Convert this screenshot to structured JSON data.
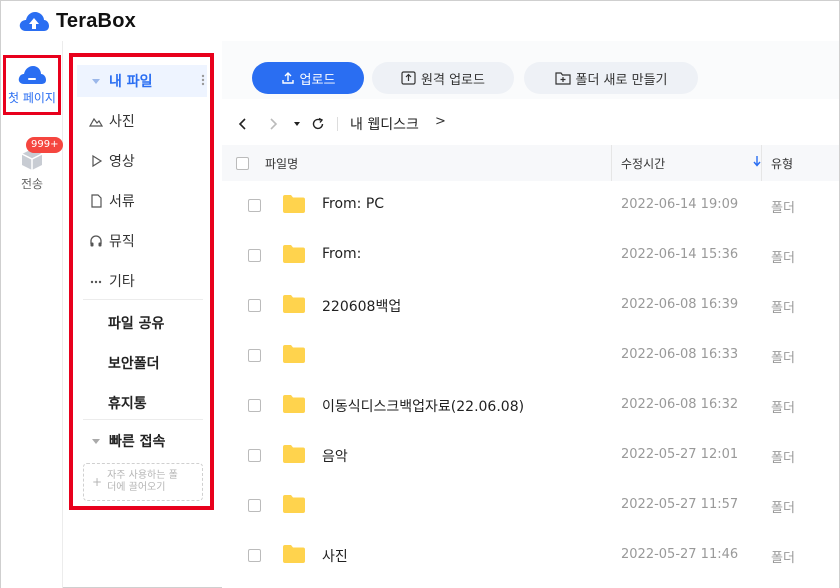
{
  "app": {
    "name": "TeraBox"
  },
  "rail": {
    "home_label": "첫 페이지",
    "transfer_label": "전송",
    "transfer_badge": "999+"
  },
  "sidebar": {
    "items": [
      {
        "label": "내 파일",
        "icon": "triangle-down-icon",
        "active": true
      },
      {
        "label": "사진",
        "icon": "mountain-icon"
      },
      {
        "label": "영상",
        "icon": "play-icon"
      },
      {
        "label": "서류",
        "icon": "document-icon"
      },
      {
        "label": "뮤직",
        "icon": "headphones-icon"
      },
      {
        "label": "기타",
        "icon": "ellipsis-icon"
      }
    ],
    "share_label": "파일 공유",
    "secure_label": "보안폴더",
    "trash_label": "휴지통",
    "quick_label": "빠른 접속",
    "quick_hint_line1": "자주 사용하는 폴",
    "quick_hint_line2": "더에 끌어오기"
  },
  "toolbar": {
    "upload_label": "업로드",
    "remote_upload_label": "원격 업로드",
    "new_folder_label": "폴더 새로 만들기"
  },
  "breadcrumb": {
    "current": "내 웹디스크",
    "arrow": ">"
  },
  "table": {
    "headers": {
      "name": "파일명",
      "time": "수정시간",
      "type": "유형"
    },
    "rows": [
      {
        "name": "From:   PC",
        "time": "2022-06-14 19:09",
        "type": "폴더"
      },
      {
        "name": "From:",
        "time": "2022-06-14 15:36",
        "type": "폴더"
      },
      {
        "name": "220608백업",
        "time": "2022-06-08 16:39",
        "type": "폴더"
      },
      {
        "name": "",
        "time": "2022-06-08 16:33",
        "type": "폴더"
      },
      {
        "name": "이동식디스크백업자료(22.06.08)",
        "time": "2022-06-08 16:32",
        "type": "폴더"
      },
      {
        "name": "음악",
        "time": "2022-05-27 12:01",
        "type": "폴더"
      },
      {
        "name": "",
        "time": "2022-05-27 11:57",
        "type": "폴더"
      },
      {
        "name": "사진",
        "time": "2022-05-27 11:46",
        "type": "폴더"
      }
    ]
  },
  "colors": {
    "accent": "#2a6ef2",
    "highlight_border": "#e8001c",
    "folder": "#ffd34d",
    "badge": "#f5463f"
  }
}
